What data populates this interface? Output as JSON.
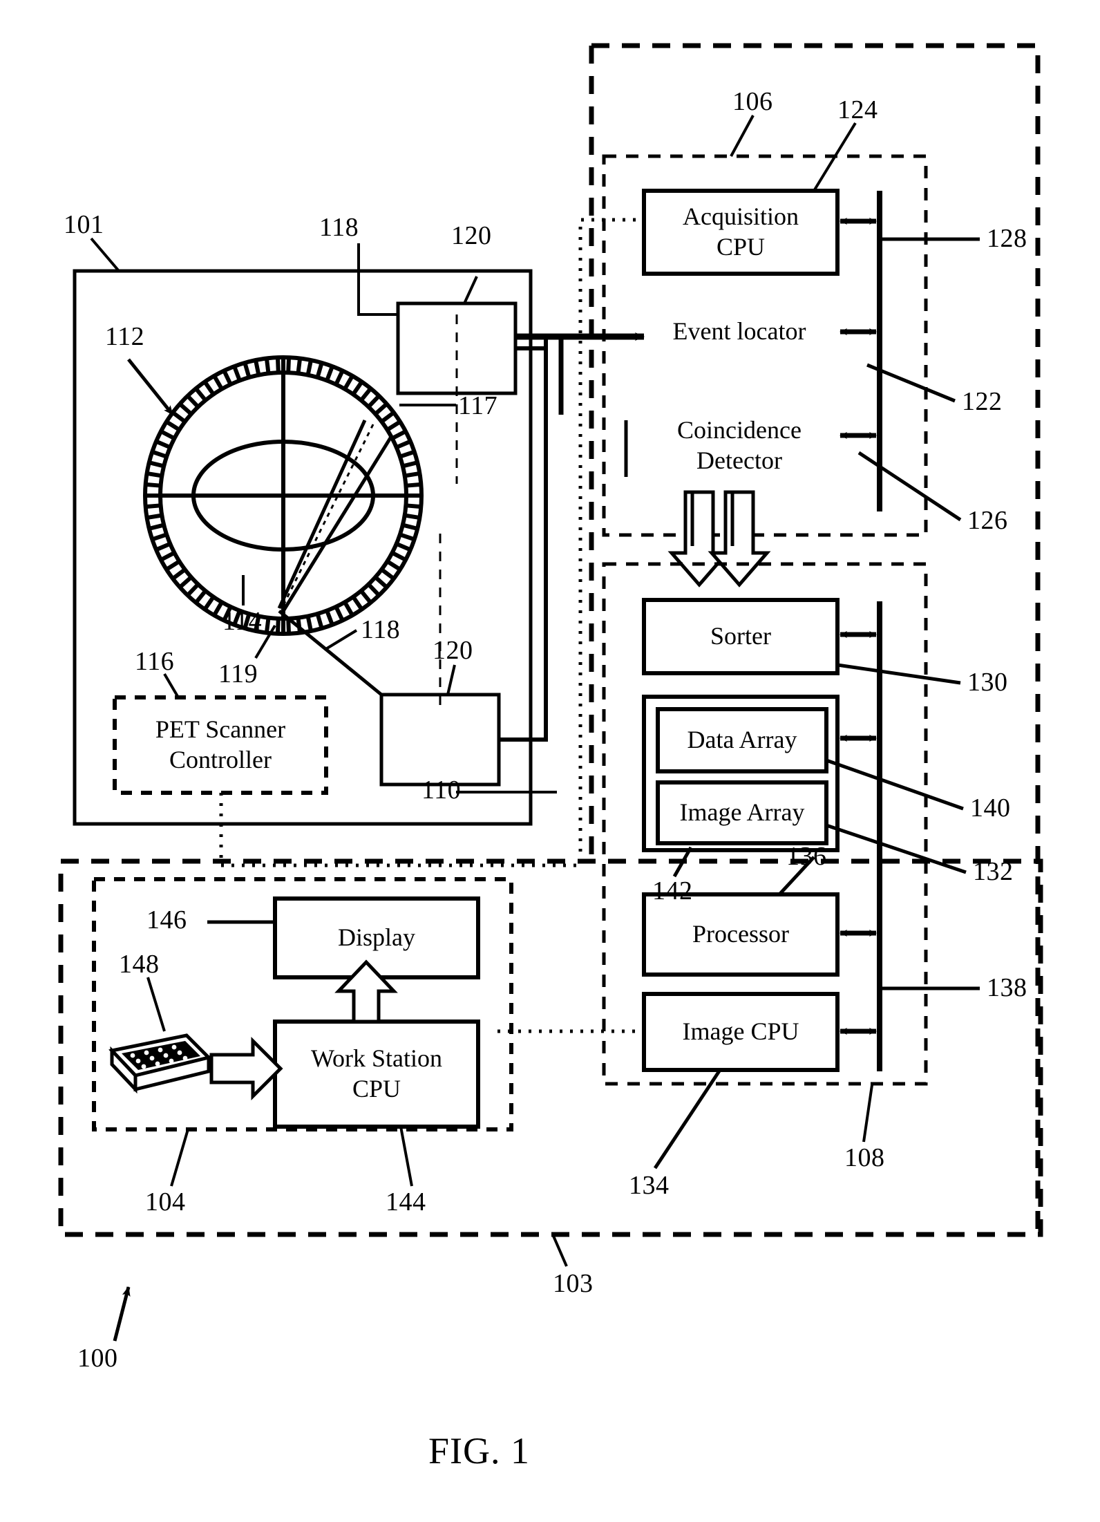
{
  "figure": {
    "caption": "FIG. 1"
  },
  "blocks": {
    "acquisition_cpu": "Acquisition\nCPU",
    "event_locator": "Event locator",
    "coincidence_detector": "Coincidence\nDetector",
    "sorter": "Sorter",
    "data_array": "Data Array",
    "image_array": "Image Array",
    "processor": "Processor",
    "image_cpu": "Image CPU",
    "display": "Display",
    "work_station_cpu": "Work Station\nCPU",
    "pet_scanner_controller": "PET Scanner\nController"
  },
  "reference_numerals": {
    "n100": "100",
    "n101": "101",
    "n103": "103",
    "n104": "104",
    "n106": "106",
    "n108": "108",
    "n110": "110",
    "n112": "112",
    "n114": "114",
    "n116": "116",
    "n117": "117",
    "n118_top": "118",
    "n118_bottom": "118",
    "n119": "119",
    "n120_top": "120",
    "n120_bottom": "120",
    "n122": "122",
    "n124": "124",
    "n126": "126",
    "n128": "128",
    "n130": "130",
    "n132": "132",
    "n134": "134",
    "n136": "136",
    "n138": "138",
    "n140": "140",
    "n142": "142",
    "n144": "144",
    "n146": "146",
    "n148": "148"
  },
  "colors": {
    "ink": "#000000",
    "paper": "#ffffff"
  }
}
